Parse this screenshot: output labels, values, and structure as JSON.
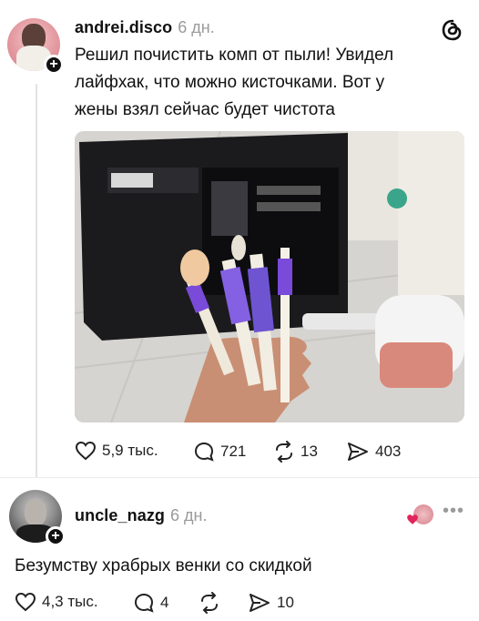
{
  "post": {
    "username": "andrei.disco",
    "time": "6 дн.",
    "text_lines": [
      "Решил почистить комп от пыли! Увидел",
      "лайфхак, что можно кисточками. Вот у",
      "жены взял сейчас будет чистота"
    ],
    "likes": "5,9 тыс.",
    "comments": "721",
    "reposts": "13",
    "shares": "403"
  },
  "reply": {
    "username": "uncle_nazg",
    "time": "6 дн.",
    "text": "Безумству храбрых венки со скидкой",
    "likes": "4,3 тыс.",
    "comments": "4",
    "shares": "10"
  },
  "colors": {
    "accent_red": "#e0245e",
    "muted": "#9a9a9a",
    "brush_purple": "#7a4ad8"
  }
}
